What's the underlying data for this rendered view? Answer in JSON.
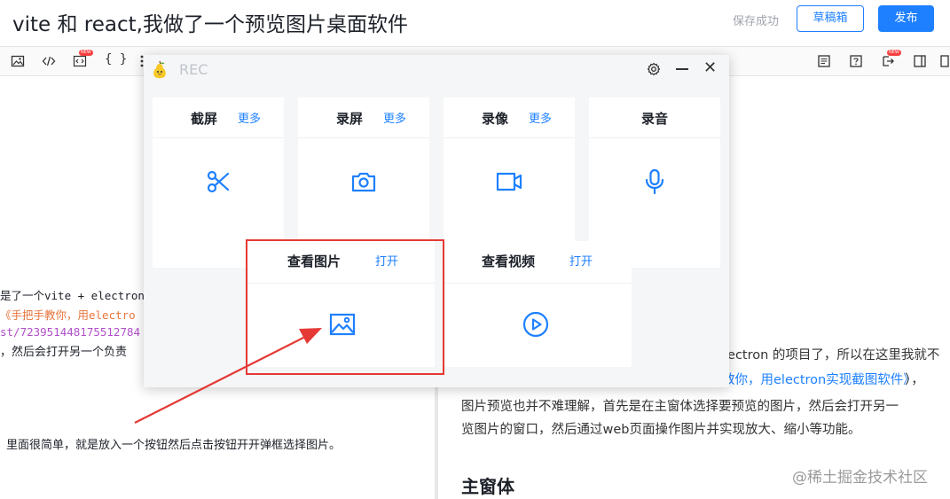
{
  "header": {
    "title": "vite 和 react,我做了一个预览图片桌面软件",
    "save_status": "保存成功",
    "draft_label": "草稿箱",
    "publish_label": "发布"
  },
  "toolbar": {
    "new_badge": "NEW",
    "curly_braces": "{ }"
  },
  "editor": {
    "lines": [
      "是了一个vite + electron",
      "《手把手教你，用electro",
      "st/723951448175512784",
      "，然后会打开另一个负责",
      "里面很简单，就是放入一个按钮然后点击按钮开开弹框选择图片。"
    ]
  },
  "preview": {
    "line1": "lectron 的项目了，所以在这里我就不",
    "line2": "教你，用electron实现截图软件》",
    "line2b": "），",
    "line3": "图片预览也并不难理解，首先是在主窗体选择要预览的图片，然后会打开另一",
    "line4": "览图片的窗口，然后通过web页面操作图片并实现放大、缩小等功能。",
    "heading": "主窗体"
  },
  "watermark": "@稀土掘金技术社区",
  "popup": {
    "title": "REC",
    "cards": [
      {
        "title": "截屏",
        "link": "更多",
        "icon": "scissors-icon"
      },
      {
        "title": "录屏",
        "link": "更多",
        "icon": "camera-icon"
      },
      {
        "title": "录像",
        "link": "更多",
        "icon": "video-camera-icon"
      },
      {
        "title": "录音",
        "link": "",
        "icon": "microphone-icon"
      },
      {
        "title": "查看图片",
        "link": "打开",
        "icon": "image-icon"
      },
      {
        "title": "查看视频",
        "link": "打开",
        "icon": "play-circle-icon"
      }
    ]
  },
  "colors": {
    "accent": "#1e80ff",
    "highlight": "#e53935"
  }
}
